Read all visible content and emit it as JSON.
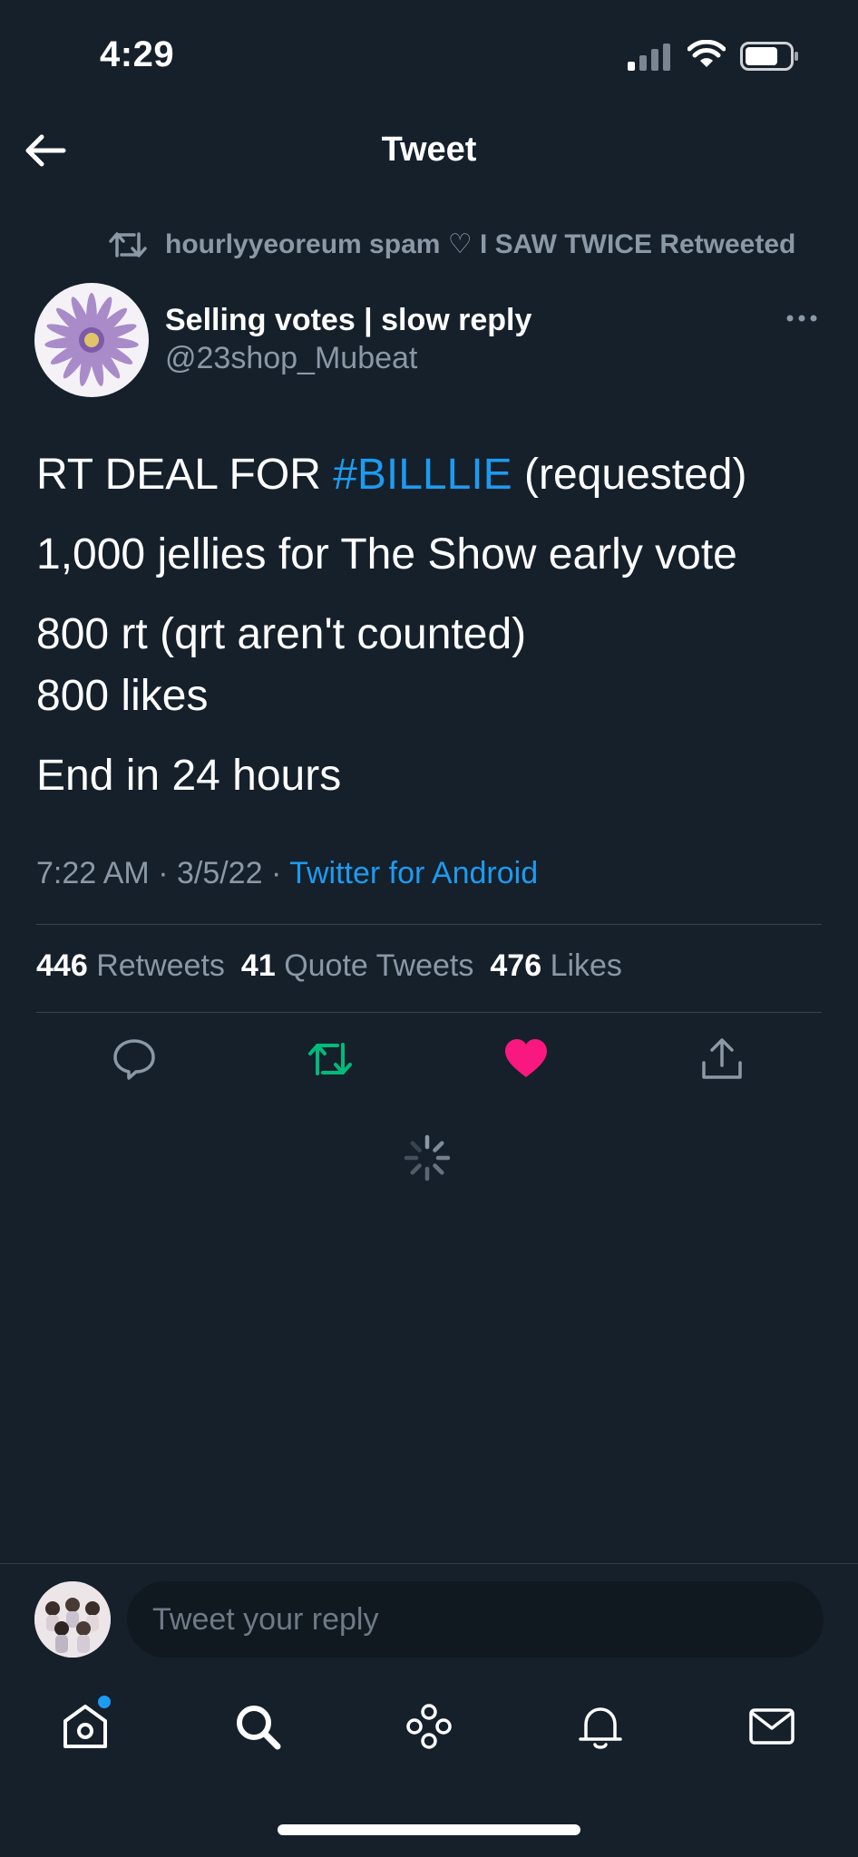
{
  "status_bar": {
    "time": "4:29"
  },
  "header": {
    "title": "Tweet"
  },
  "retweet_banner": {
    "text": "hourlyyeoreum spam ♡ I SAW TWICE Retweeted"
  },
  "author": {
    "display_name": "Selling votes | slow reply",
    "handle": "@23shop_Mubeat"
  },
  "tweet": {
    "line1_prefix": "RT DEAL FOR ",
    "line1_hashtag": "#BILLLIE",
    "line1_suffix": " (requested)",
    "line2": "1,000 jellies for The Show early vote",
    "line3": "800 rt (qrt aren't counted)",
    "line4": "800 likes",
    "line5": "End in 24 hours"
  },
  "meta": {
    "time": "7:22 AM",
    "date": "3/5/22",
    "sep": " · ",
    "source": "Twitter for Android"
  },
  "stats": {
    "retweets_count": "446",
    "retweets_label": "Retweets",
    "quotes_count": "41",
    "quotes_label": "Quote Tweets",
    "likes_count": "476",
    "likes_label": "Likes"
  },
  "actions": [
    "reply-icon",
    "retweet-icon",
    "heart-icon",
    "share-icon"
  ],
  "reply": {
    "placeholder": "Tweet your reply"
  },
  "tabs": [
    "home-icon",
    "search-icon",
    "spaces-icon",
    "bell-icon",
    "mail-icon"
  ],
  "colors": {
    "background": "#15202b",
    "accent": "#1d9bf0",
    "retweet": "#00ba7c",
    "like": "#f91880",
    "muted": "#8b98a5"
  }
}
